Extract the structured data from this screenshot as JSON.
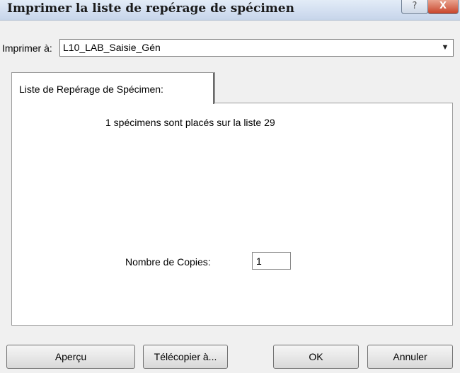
{
  "window": {
    "title": "Imprimer la liste de repérage de spécimen",
    "help_glyph": "?",
    "close_glyph": "X"
  },
  "printer": {
    "label": "Imprimer à:",
    "selected": "L10_LAB_Saisie_Gén",
    "arrow_glyph": "▼"
  },
  "tab": {
    "label": "Liste de Repérage de Spécimen:"
  },
  "panel": {
    "info": "1 spécimens sont placés sur la liste 29",
    "copies_label": "Nombre de Copies:",
    "copies_value": "1"
  },
  "buttons": {
    "apercu": "Aperçu",
    "telecopier": "Télécopier à...",
    "ok": "OK",
    "annuler": "Annuler"
  }
}
